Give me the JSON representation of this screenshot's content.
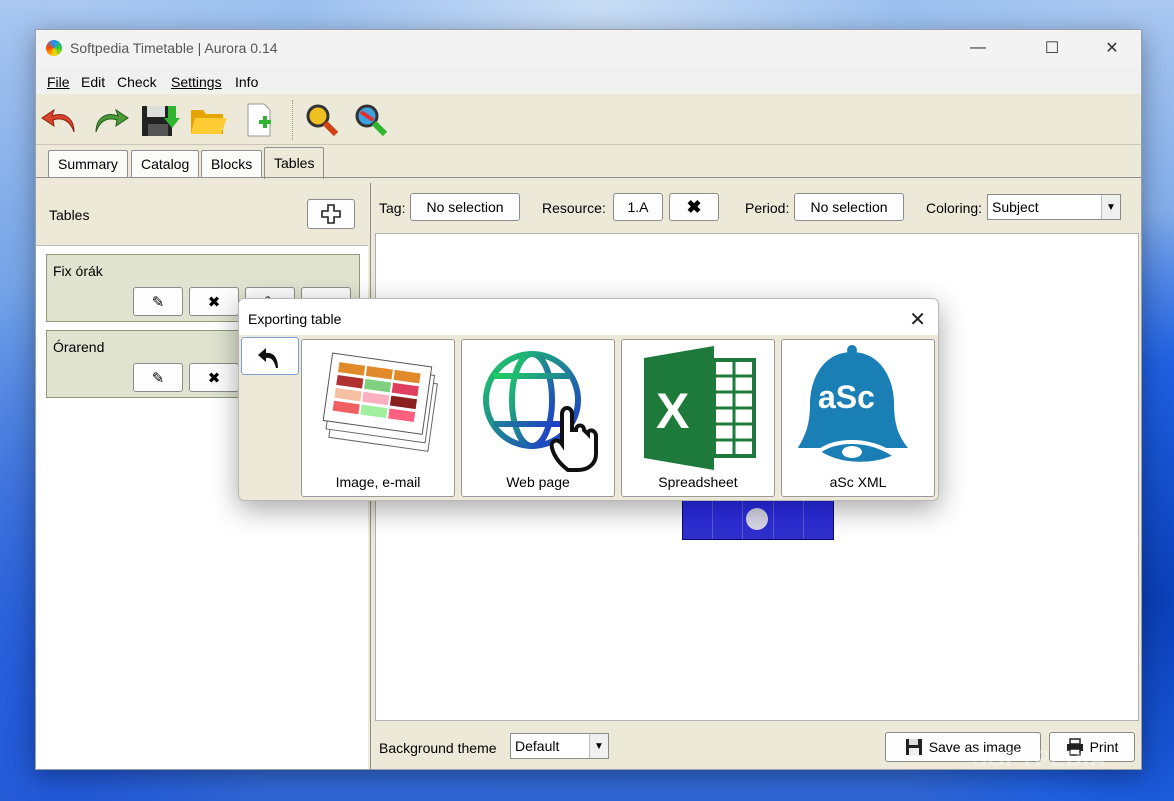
{
  "window": {
    "title": "Softpedia Timetable | Aurora 0.14"
  },
  "menu": [
    "File",
    "Edit",
    "Check",
    "Settings",
    "Info"
  ],
  "toolbar": {
    "icons": [
      "undo-icon",
      "redo-icon",
      "save-icon",
      "open-folder-icon",
      "new-file-icon",
      "search-icon",
      "search-color-icon"
    ]
  },
  "tabs": [
    "Summary",
    "Catalog",
    "Blocks",
    "Tables"
  ],
  "active_tab": "Tables",
  "left_panel": {
    "heading": "Tables",
    "tables": [
      {
        "name": "Fix órák"
      },
      {
        "name": "Órarend"
      }
    ]
  },
  "filters": {
    "tag_label": "Tag:",
    "tag_value": "No selection",
    "resource_label": "Resource:",
    "resource_value": "1.A",
    "period_label": "Period:",
    "period_value": "No selection",
    "coloring_label": "Coloring:",
    "coloring_value": "Subject"
  },
  "footer": {
    "bg_theme_label": "Background theme",
    "bg_theme_value": "Default",
    "save_image_label": "Save as image",
    "print_label": "Print"
  },
  "dialog": {
    "title": "Exporting table",
    "options": [
      {
        "label": "Image, e-mail",
        "icon": "image-email-icon"
      },
      {
        "label": "Web page",
        "icon": "web-page-icon"
      },
      {
        "label": "Spreadsheet",
        "icon": "spreadsheet-icon"
      },
      {
        "label": "aSc XML",
        "icon": "asc-xml-icon"
      }
    ]
  },
  "watermark": "SOFTPEDIA"
}
